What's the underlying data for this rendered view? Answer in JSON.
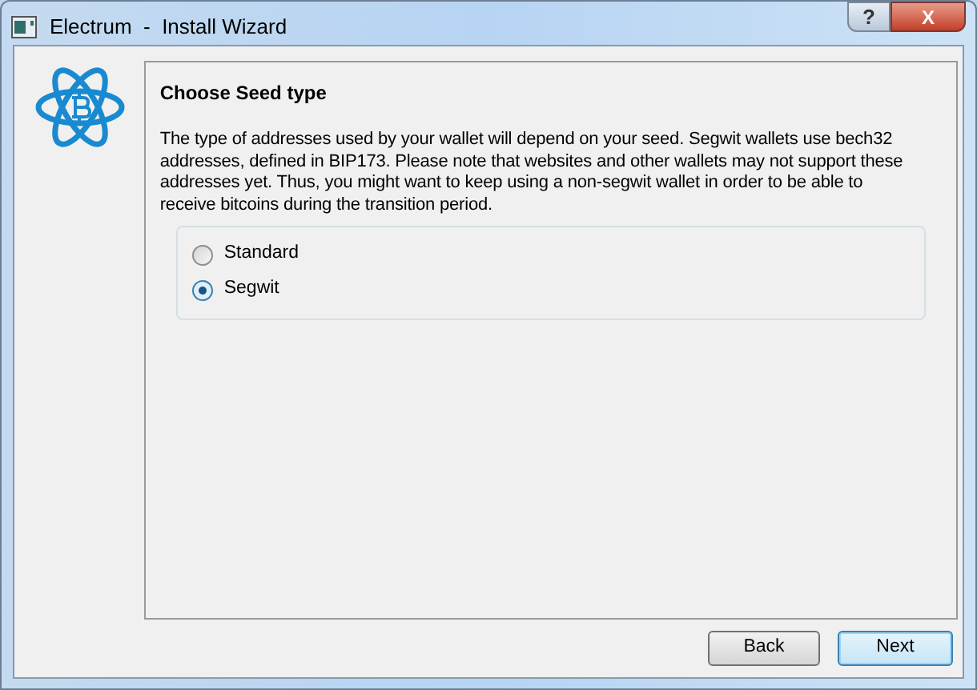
{
  "window": {
    "title": "Electrum  -  Install Wizard",
    "buttons": [
      "?",
      "X"
    ]
  },
  "page": {
    "heading": "Choose Seed type",
    "description": "The type of addresses used by your wallet will depend on your seed. Segwit wallets use bech32 addresses, defined in BIP173. Please note that websites and other wallets may not support these addresses yet. Thus, you might want to keep using a non-segwit wallet in order to be able to receive bitcoins during the transition period.",
    "options": [
      {
        "label": "Standard",
        "selected": false
      },
      {
        "label": "Segwit",
        "selected": true
      }
    ]
  },
  "footer": {
    "buttons": [
      {
        "label": "Back",
        "default": false
      },
      {
        "label": "Next",
        "default": true
      }
    ]
  }
}
